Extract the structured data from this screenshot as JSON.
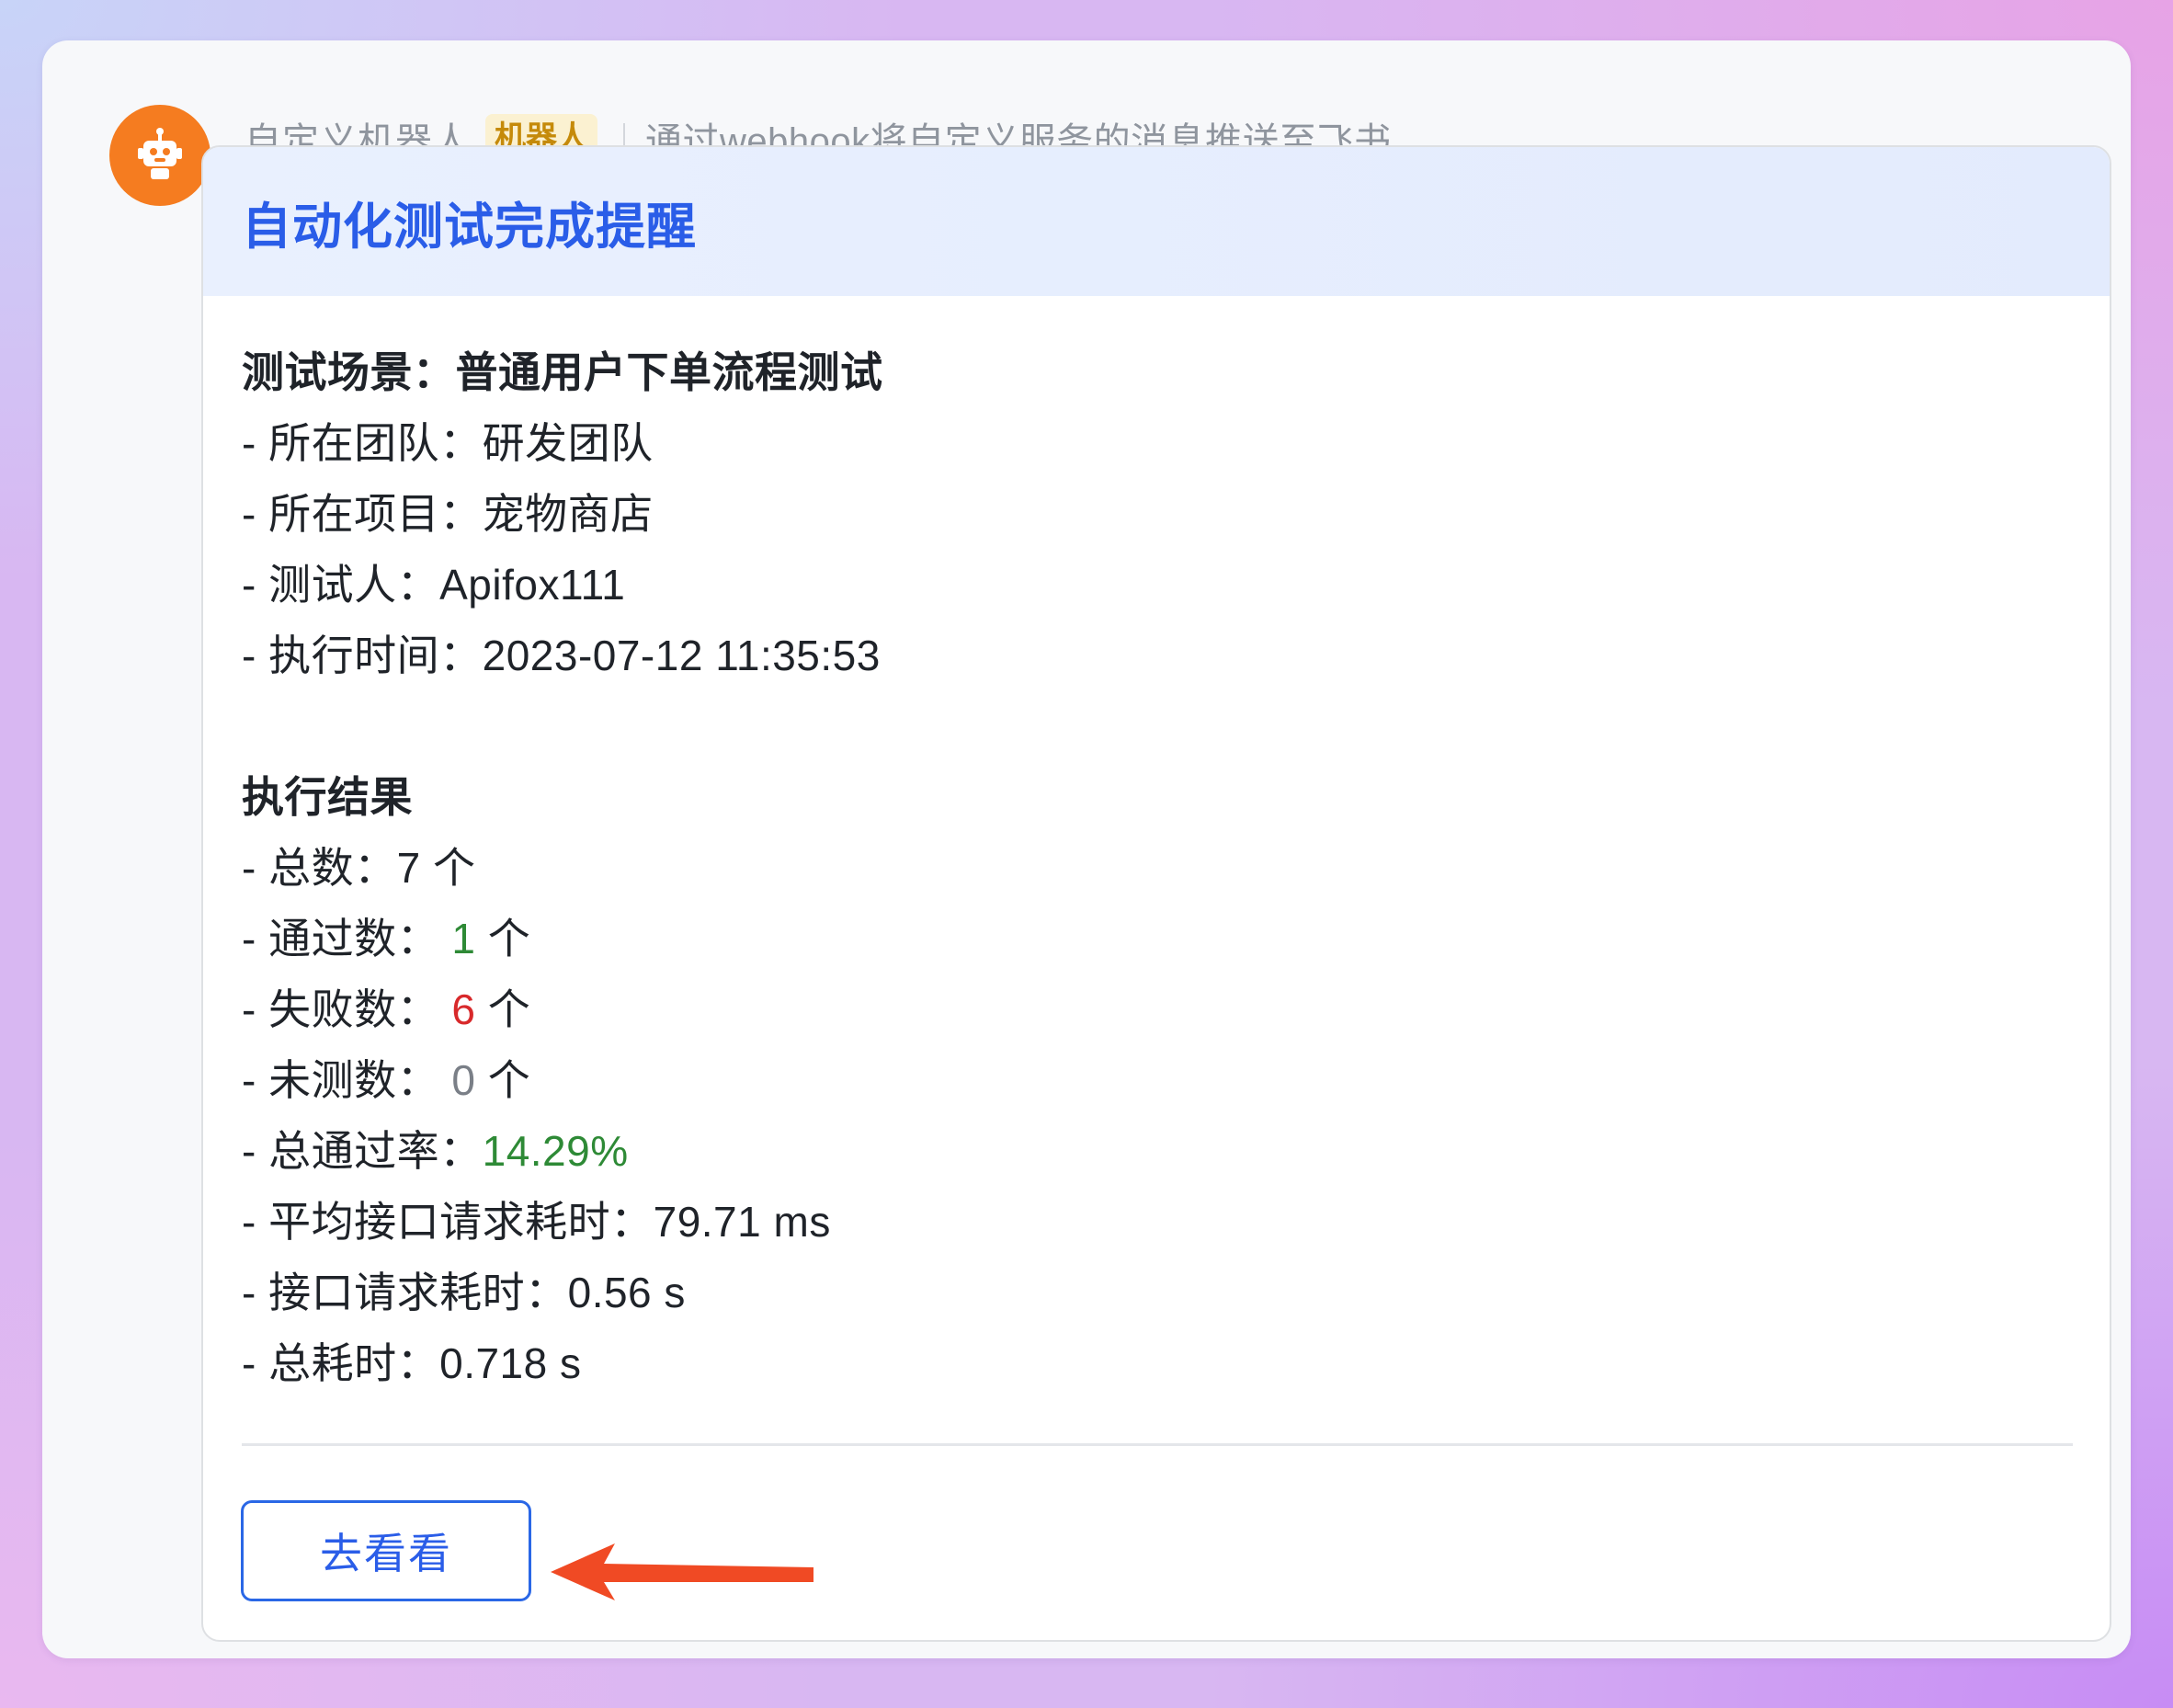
{
  "sender": {
    "name": "自定义机器人",
    "badge": "机器人",
    "description": "通过webhook将自定义服务的消息推送至飞书",
    "avatar_icon": "robot-icon",
    "avatar_color": "#f57c20"
  },
  "card": {
    "title": "自动化测试完成提醒",
    "scenario": "测试场景：普通用户下单流程测试",
    "info": {
      "team_label": "- 所在团队：",
      "team_value": "研发团队",
      "project_label": "- 所在项目：",
      "project_value": "宠物商店",
      "tester_label": "- 测试人：",
      "tester_value": "Apifox111",
      "time_label": "- 执行时间：",
      "time_value": "2023-07-12 11:35:53"
    },
    "results_heading": "执行结果",
    "results": {
      "total_label": "- 总数：",
      "total_value": "7 个",
      "passed_label": "- 通过数：",
      "passed_value": "1",
      "failed_label": "- 失败数：",
      "failed_value": "6",
      "untested_label": "- 未测数：",
      "untested_value": "0",
      "count_unit": "个",
      "pass_rate_label": "- 总通过率：",
      "pass_rate_value": "14.29%",
      "avg_time_label": "- 平均接口请求耗时：",
      "avg_time_value": "79.71 ms",
      "req_time_label": "- 接口请求耗时：",
      "req_time_value": "0.56 s",
      "total_time_label": "- 总耗时：",
      "total_time_value": "0.718 s"
    },
    "button_label": "去看看"
  },
  "colors": {
    "title_blue": "#2a5de8",
    "pass_green": "#2e8a36",
    "fail_red": "#d8292b",
    "untested_gray": "#7a7f87",
    "arrow": "#f04a24",
    "badge_bg": "#fbf1d1",
    "badge_text": "#c58a0a"
  }
}
